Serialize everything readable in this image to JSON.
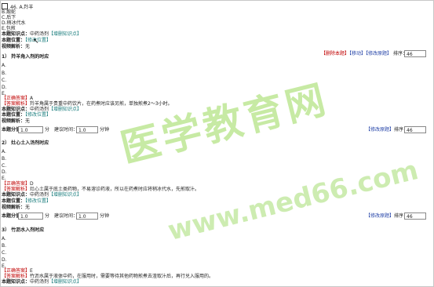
{
  "top": {
    "option_a": "46. A.羚羊",
    "option_b": "B.煅蛇",
    "option_c": "C.后下",
    "option_d": "D.稍冰代水",
    "option_e": "E.包煎",
    "kp_label": "本题知识点：",
    "kp_value": "中药汤剂",
    "kp_add": "【增删知识点】",
    "pos_label": "本题位置：",
    "pos_edit": "【修改位置】",
    "video_label": "视频解析：",
    "video_value": "无"
  },
  "toolbar": {
    "delete": "【删除本题】",
    "move": "【移动】",
    "edit_orig": "【修改原题】",
    "sort_label": "排序："
  },
  "questions": [
    {
      "title": "1） 羚羊角入剂的时应",
      "sort": "46",
      "options": [
        "A.",
        "B.",
        "C.",
        "D.",
        "E."
      ],
      "answer_label": "【正确答案】",
      "answer": "A",
      "explain_label": "【答案解析】",
      "explain": "羚羊角属于贵重中药饮片，在药煮时应该另煎，单独煎煮2～3小时。",
      "kp_label": "本题知识点：",
      "kp_value": "中药汤剂",
      "kp_add": "【增删知识点】",
      "pos_label": "本题位置：",
      "pos_edit": "【修改位置】",
      "video_label": "视频解析：",
      "video_value": "无",
      "score_label": "本题分值：",
      "score": "1.0",
      "score_unit": "分",
      "time_label": "建议时间：",
      "time": "1.0",
      "time_unit": "分钟"
    },
    {
      "title": "2） 灶心土入汤剂时应",
      "sort": "46",
      "options": [
        "A.",
        "B.",
        "C.",
        "D.",
        "E."
      ],
      "answer_label": "【正确答案】",
      "answer": "D",
      "explain_label": "【答案解析】",
      "explain": "灶心土属于底土类药物，不易溶诊药液，所以在药煮时应将稍冰代水，先煎取汁。",
      "kp_label": "本题知识点：",
      "kp_value": "中药汤剂",
      "kp_add": "【增删知识点】",
      "pos_label": "本题位置：",
      "pos_edit": "【修改位置】",
      "video_label": "视频解析：",
      "video_value": "无",
      "score_label": "本题分值：",
      "score": "1.0",
      "score_unit": "分",
      "time_label": "建议时间：",
      "time": "1.0",
      "time_unit": "分钟"
    },
    {
      "title": "3） 竹沥水入剂时应",
      "sort": "46",
      "options": [
        "A.",
        "B.",
        "C.",
        "D.",
        "E."
      ],
      "answer_label": "【正确答案】",
      "answer": "E",
      "explain_label": "【答案解析】",
      "explain": "竹沥水属于液体中药，在服用时，需要等待其他药物煎煮去渣取汁后，再行兑入服用的。",
      "kp_label": "本题知识点：",
      "kp_value": "中药汤剂",
      "kp_add": "【增删知识点】"
    }
  ],
  "watermark": {
    "line1": "医学教育网",
    "line2": "www.med66.com"
  },
  "colors": {
    "red": "#c00000",
    "blue": "#1f3fa6",
    "teal": "#1a7d7d",
    "watermark": "#9bd95b"
  }
}
